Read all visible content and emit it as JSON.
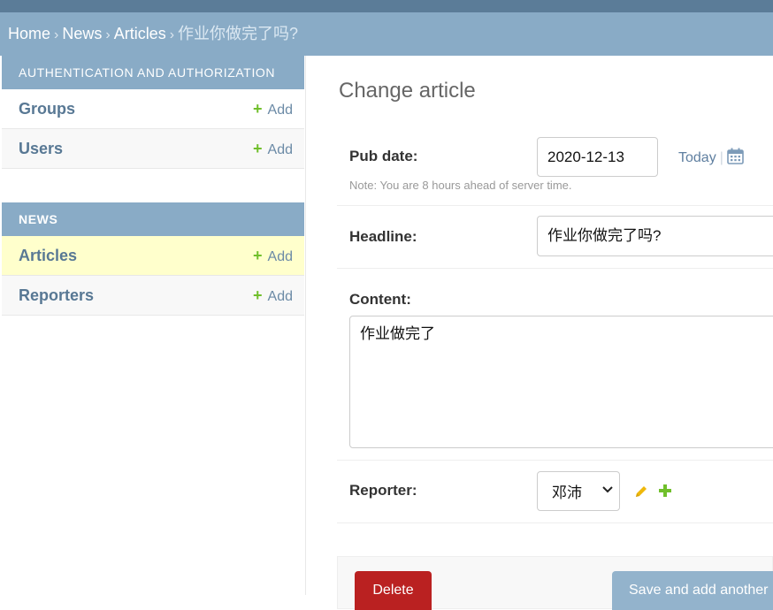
{
  "breadcrumbs": {
    "home": "Home",
    "app": "News",
    "model": "Articles",
    "current": "作业你做完了吗?",
    "separator": "›"
  },
  "sidebar": {
    "modules": [
      {
        "caption": "AUTHENTICATION AND AUTHORIZATION",
        "items": [
          {
            "label": "Groups",
            "add_label": "Add"
          },
          {
            "label": "Users",
            "add_label": "Add"
          }
        ]
      },
      {
        "caption": "NEWS",
        "items": [
          {
            "label": "Articles",
            "add_label": "Add",
            "selected": true
          },
          {
            "label": "Reporters",
            "add_label": "Add"
          }
        ]
      }
    ]
  },
  "form": {
    "title": "Change article",
    "pub_date": {
      "label": "Pub date:",
      "value": "2020-12-13",
      "today_label": "Today",
      "separator": "|",
      "help": "Note: You are 8 hours ahead of server time."
    },
    "headline": {
      "label": "Headline:",
      "value": "作业你做完了吗?"
    },
    "content": {
      "label": "Content:",
      "value": "作业做完了"
    },
    "reporter": {
      "label": "Reporter:",
      "selected": "邓沛"
    }
  },
  "actions": {
    "delete_label": "Delete",
    "save_add_another_label": "Save and add another"
  },
  "icons": {
    "add": "plus-icon",
    "calendar": "calendar-icon",
    "edit": "pencil-icon",
    "dropdown": "chevron-down-icon"
  },
  "colors": {
    "header": "#5b7c98",
    "breadcrumb_bg": "#89abc6",
    "link": "#587894",
    "add_green": "#70bf2b",
    "selected_row": "#ffffcc",
    "delete": "#ba2121",
    "pencil": "#efb80b"
  }
}
